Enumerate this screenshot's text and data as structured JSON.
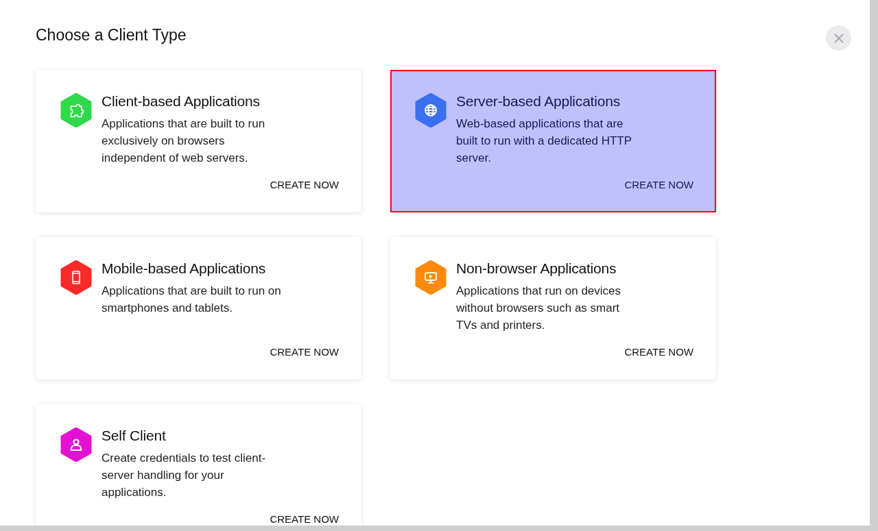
{
  "dialog": {
    "title": "Choose a Client Type"
  },
  "cards": [
    {
      "kind": "puzzle",
      "color": "#2fd94a",
      "title": "Client-based Applications",
      "description": "Applications that are built to run exclusively on browsers independent of web servers.",
      "action": "CREATE NOW",
      "selected": false
    },
    {
      "kind": "globe",
      "color": "#3a6ff0",
      "title": "Server-based Applications",
      "description": "Web-based applications that are built to run with a dedicated HTTP server.",
      "action": "CREATE NOW",
      "selected": true
    },
    {
      "kind": "phone",
      "color": "#fb2a2a",
      "title": "Mobile-based Applications",
      "description": "Applications that are built to run on smartphones and tablets.",
      "action": "CREATE NOW",
      "selected": false
    },
    {
      "kind": "monitor",
      "color": "#fd8a0c",
      "title": "Non-browser Applications",
      "description": "Applications that run on devices without browsers such as smart TVs and printers.",
      "action": "CREATE NOW",
      "selected": false
    },
    {
      "kind": "person",
      "color": "#e312d2",
      "title": "Self Client",
      "description": "Create credentials to test client-server handling for your applications.",
      "action": "CREATE NOW",
      "selected": false
    }
  ]
}
